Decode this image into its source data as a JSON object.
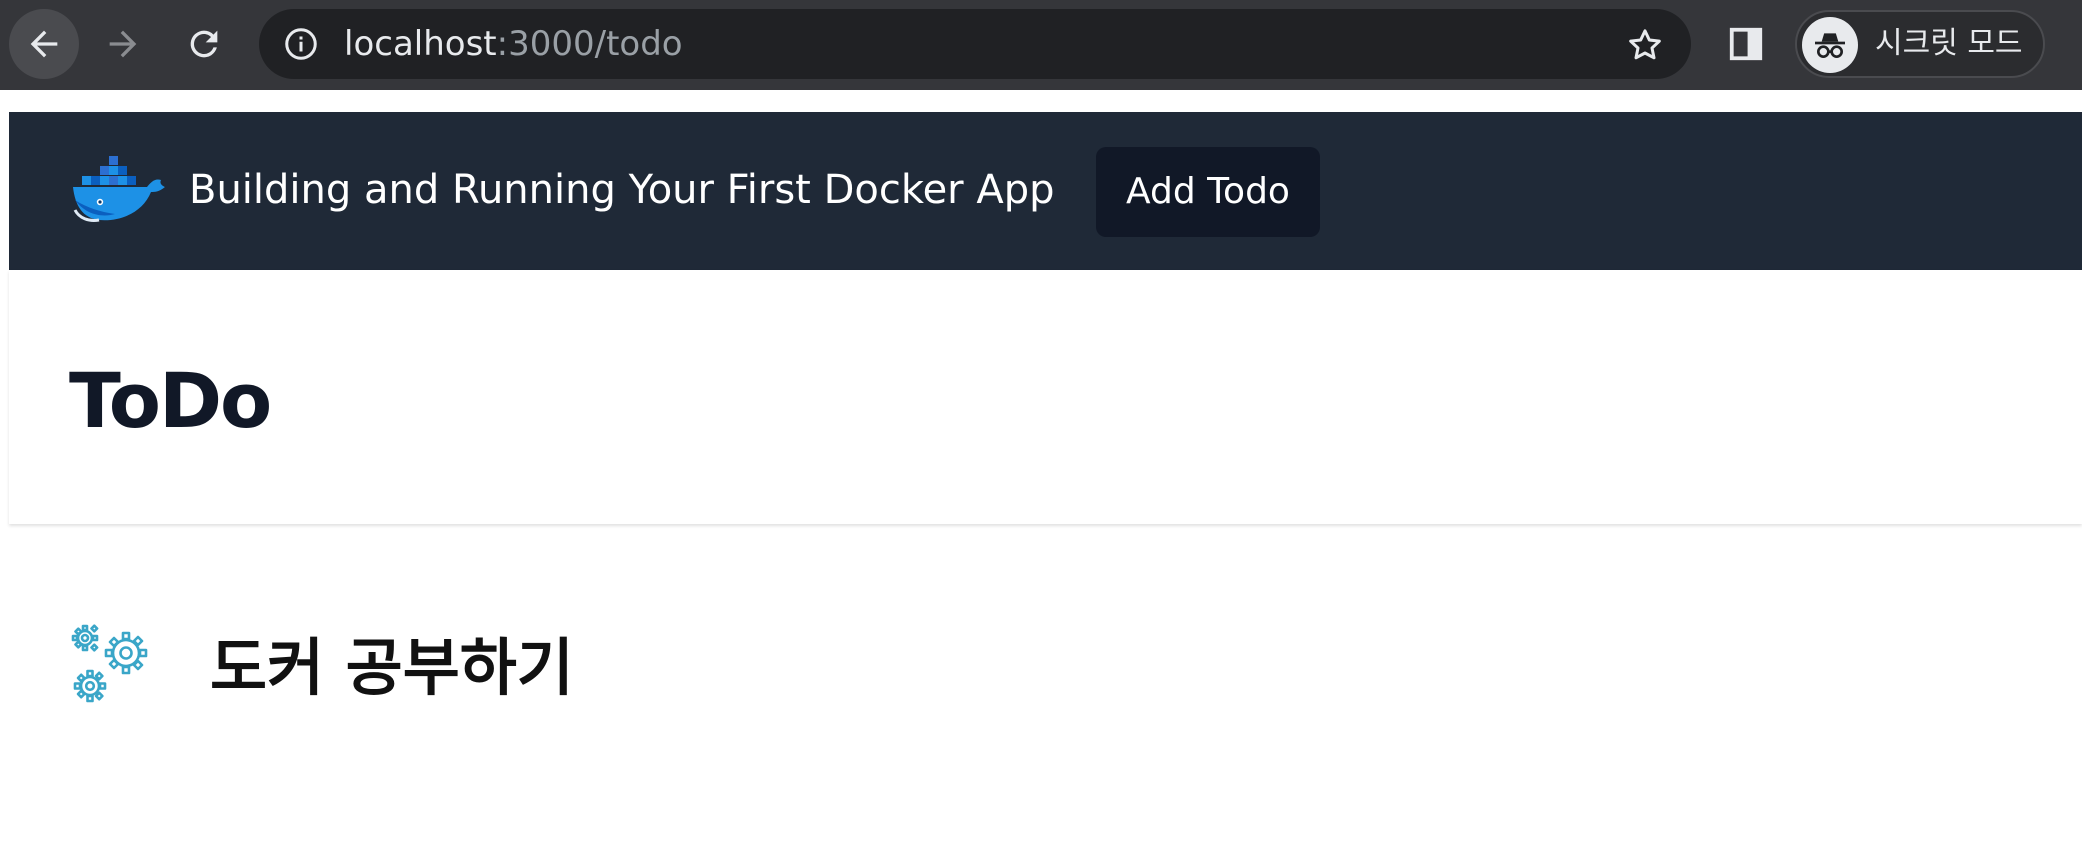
{
  "browser": {
    "url_host": "localhost",
    "url_path": ":3000/todo",
    "incognito_label": "시크릿 모드",
    "icons": [
      "back-arrow-icon",
      "forward-arrow-icon",
      "reload-icon",
      "info-icon",
      "bookmark-star-icon",
      "side-panel-icon",
      "incognito-icon"
    ]
  },
  "navbar": {
    "brand": "Building and Running Your First Docker App",
    "add_todo_label": "Add Todo",
    "logo_icon": "docker-whale-icon"
  },
  "header": {
    "title": "ToDo"
  },
  "todos": [
    {
      "text": "도커 공부하기",
      "icon": "gears-icon"
    }
  ],
  "colors": {
    "chrome_bg": "#35363a",
    "omnibox_bg": "#202124",
    "navbar_bg": "#1f2937",
    "button_bg": "#111827",
    "docker_blue": "#1d91e6",
    "gear_color": "#3aa6c8"
  }
}
